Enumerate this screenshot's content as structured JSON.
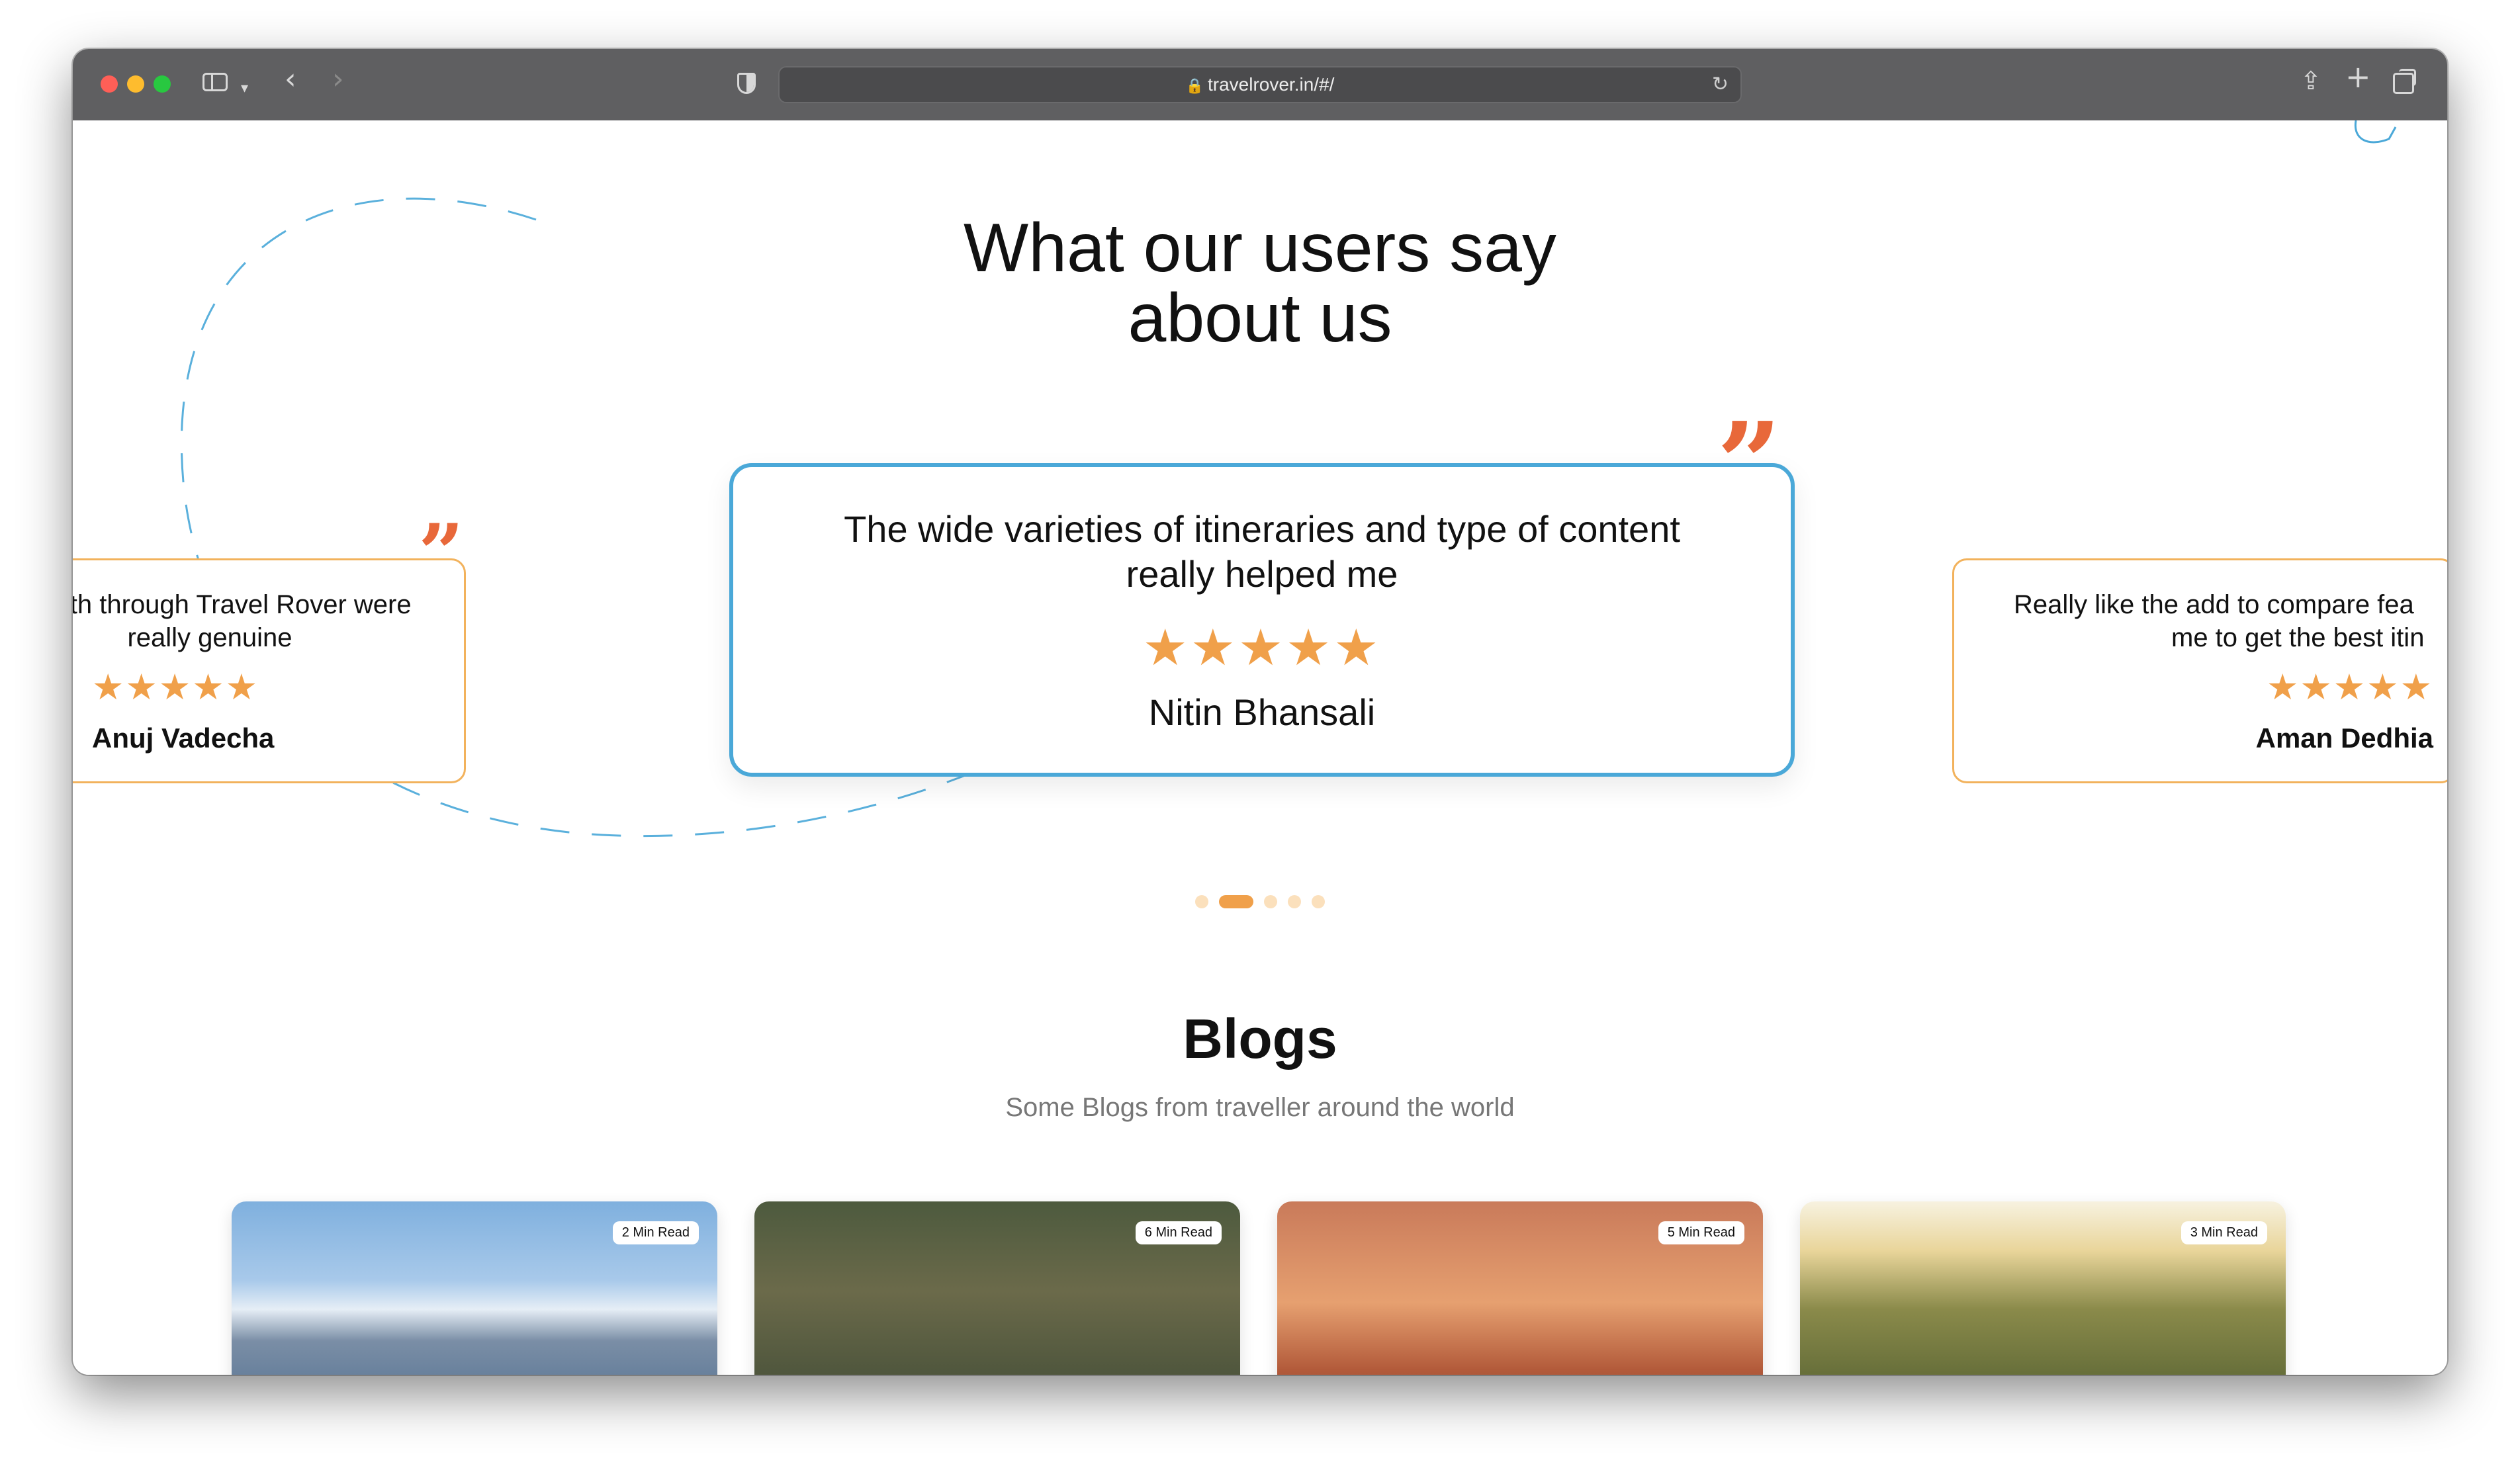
{
  "browser": {
    "url": "travelrover.in/#/"
  },
  "testimonials": {
    "title_line1": "What our users say",
    "title_line2": "about us",
    "center": {
      "text": "The wide varieties of itineraries and type of content really helped me",
      "rating": 5,
      "stars": "★★★★★",
      "name": "Nitin Bhansali"
    },
    "left": {
      "text_line1": "ed with through Travel Rover were",
      "text_line2": "really genuine",
      "rating": 5,
      "stars": "★★★★★",
      "name": "Anuj Vadecha"
    },
    "right": {
      "text_line1": "Really like the add to compare fea",
      "text_line2": "me to get the best itin",
      "rating": 5,
      "stars": "★★★★★",
      "name": "Aman Dedhia"
    },
    "quote_glyph": "”",
    "carousel": {
      "count": 5,
      "active_index": 1
    }
  },
  "blogs": {
    "title": "Blogs",
    "subtitle": "Some Blogs from traveller around the world",
    "cards": [
      {
        "read_time": "2 Min Read"
      },
      {
        "read_time": "6 Min Read"
      },
      {
        "read_time": "5 Min Read"
      },
      {
        "read_time": "3 Min Read"
      }
    ]
  },
  "colors": {
    "accent_orange": "#f0a04a",
    "quote_red": "#e8683a",
    "card_border_blue": "#4aa8d8"
  }
}
